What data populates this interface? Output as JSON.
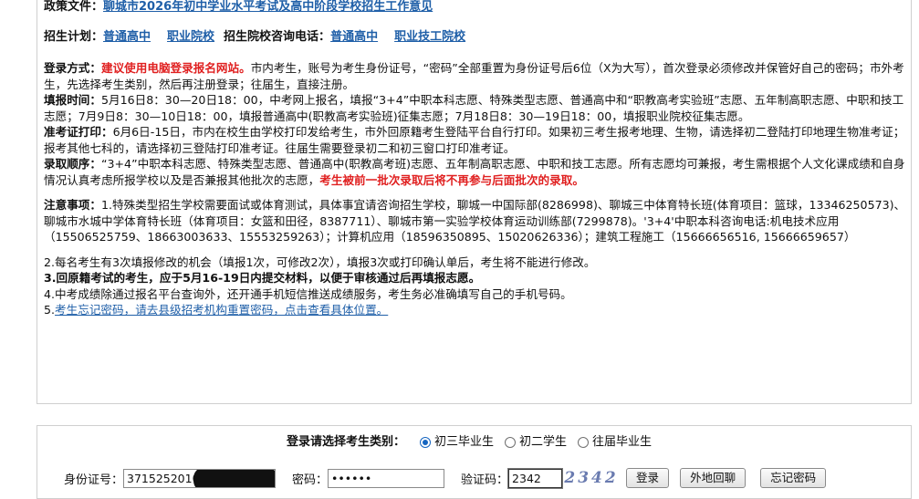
{
  "policy": {
    "label": "政策文件：",
    "link": "聊城市2026年初中学业水平考试及高中阶段学校招生工作意见"
  },
  "plan": {
    "label": "招生计划：",
    "link1": "普通高中",
    "link2": "职业院校",
    "consult_label": "招生院校咨询电话：",
    "link3": "普通高中",
    "link4": "职业技工院校"
  },
  "info": {
    "login_label": "登录方式：",
    "login_red": "建议使用电脑登录报名网站。",
    "login_text": "市内考生，账号为考生身份证号，“密码”全部重置为身份证号后6位（X为大写），首次登录必须修改并保管好自己的密码；市外考生，先选择考生类别，然后再注册登录；往届生，直接注册。",
    "fill_label": "填报时间：",
    "fill_text": "5月16日8：30—20日18：00，中考网上报名，填报“3+4”中职本科志愿、特殊类型志愿、普通高中和“职教高考实验班”志愿、五年制高职志愿、中职和技工志愿；7月9日8：30—10日18：00，填报普通高中(职教高考实验班)征集志愿；7月18日8：30—19日18：00，填报职业院校征集志愿。",
    "ticket_label": "准考证打印：",
    "ticket_text": "6月6日-15日，市内在校生由学校打印发给考生，市外回原籍考生登陆平台自行打印。如果初三考生报考地理、生物，请选择初二登陆打印地理生物准考证；报考其他七科的，请选择初三登陆打印准考证。往届生需要登录初二和初三窗口打印准考证。",
    "order_label": "录取顺序：",
    "order_text": "“3+4”中职本科志愿、特殊类型志愿、普通高中(职教高考班)志愿、五年制高职志愿、中职和技工志愿。所有志愿均可兼报，考生需根据个人文化课成绩和自身情况认真考虑所报学校以及是否兼报其他批次的志愿，",
    "order_red": "考生被前一批次录取后将不再参与后面批次的录取。",
    "notes_label": "注意事项：",
    "note1": "1.特殊类型招生学校需要面试或体育测试，具体事宜请咨询招生学校，聊城一中国际部(8286998)、聊城三中体育特长班(体育项目：篮球，13346250573)、聊城市水城中学体育特长班（体育项目：女篮和田径，8387711）、聊城市第一实验学校体育运动训练部(7299878)。'3+4'中职本科咨询电话:机电技术应用（15506525759、18663003633、15553259263）；计算机应用（18596350895、15020626336）；建筑工程施工（15666656516, 15666659657）",
    "note2": "2.每名考生有3次填报修改的机会（填报1次，可修改2次），填报3次或打印确认单后，考生将不能进行修改。",
    "note3": "3.回原籍考试的考生，应于5月16-19日内提交材料，以便于审核通过后再填报志愿。",
    "note4": "4.中考成绩除通过报名平台查询外，还开通手机短信推送成绩服务，考生务必准确填写自己的手机号码。",
    "note5_prefix": "5.",
    "note5_link": "考生忘记密码，请去县级招考机构重置密码，点击查看具体位置。"
  },
  "login": {
    "type_label": "登录请选择考生类别：",
    "options": [
      "初三毕业生",
      "初二学生",
      "往届毕业生"
    ],
    "selected": "初三毕业生",
    "id_label": "身份证号：",
    "id_value": "3715252010",
    "pwd_label": "密码：",
    "pwd_value": "••••••",
    "captcha_label": "验证码：",
    "captcha_value": "2342",
    "captcha_image_text": "2342",
    "btn_login": "登录",
    "btn_outside": "外地回聊",
    "btn_forgot": "忘记密码"
  },
  "colors": {
    "link": "#1f5fa8",
    "red": "#e02020",
    "radio": "#1565c0"
  }
}
